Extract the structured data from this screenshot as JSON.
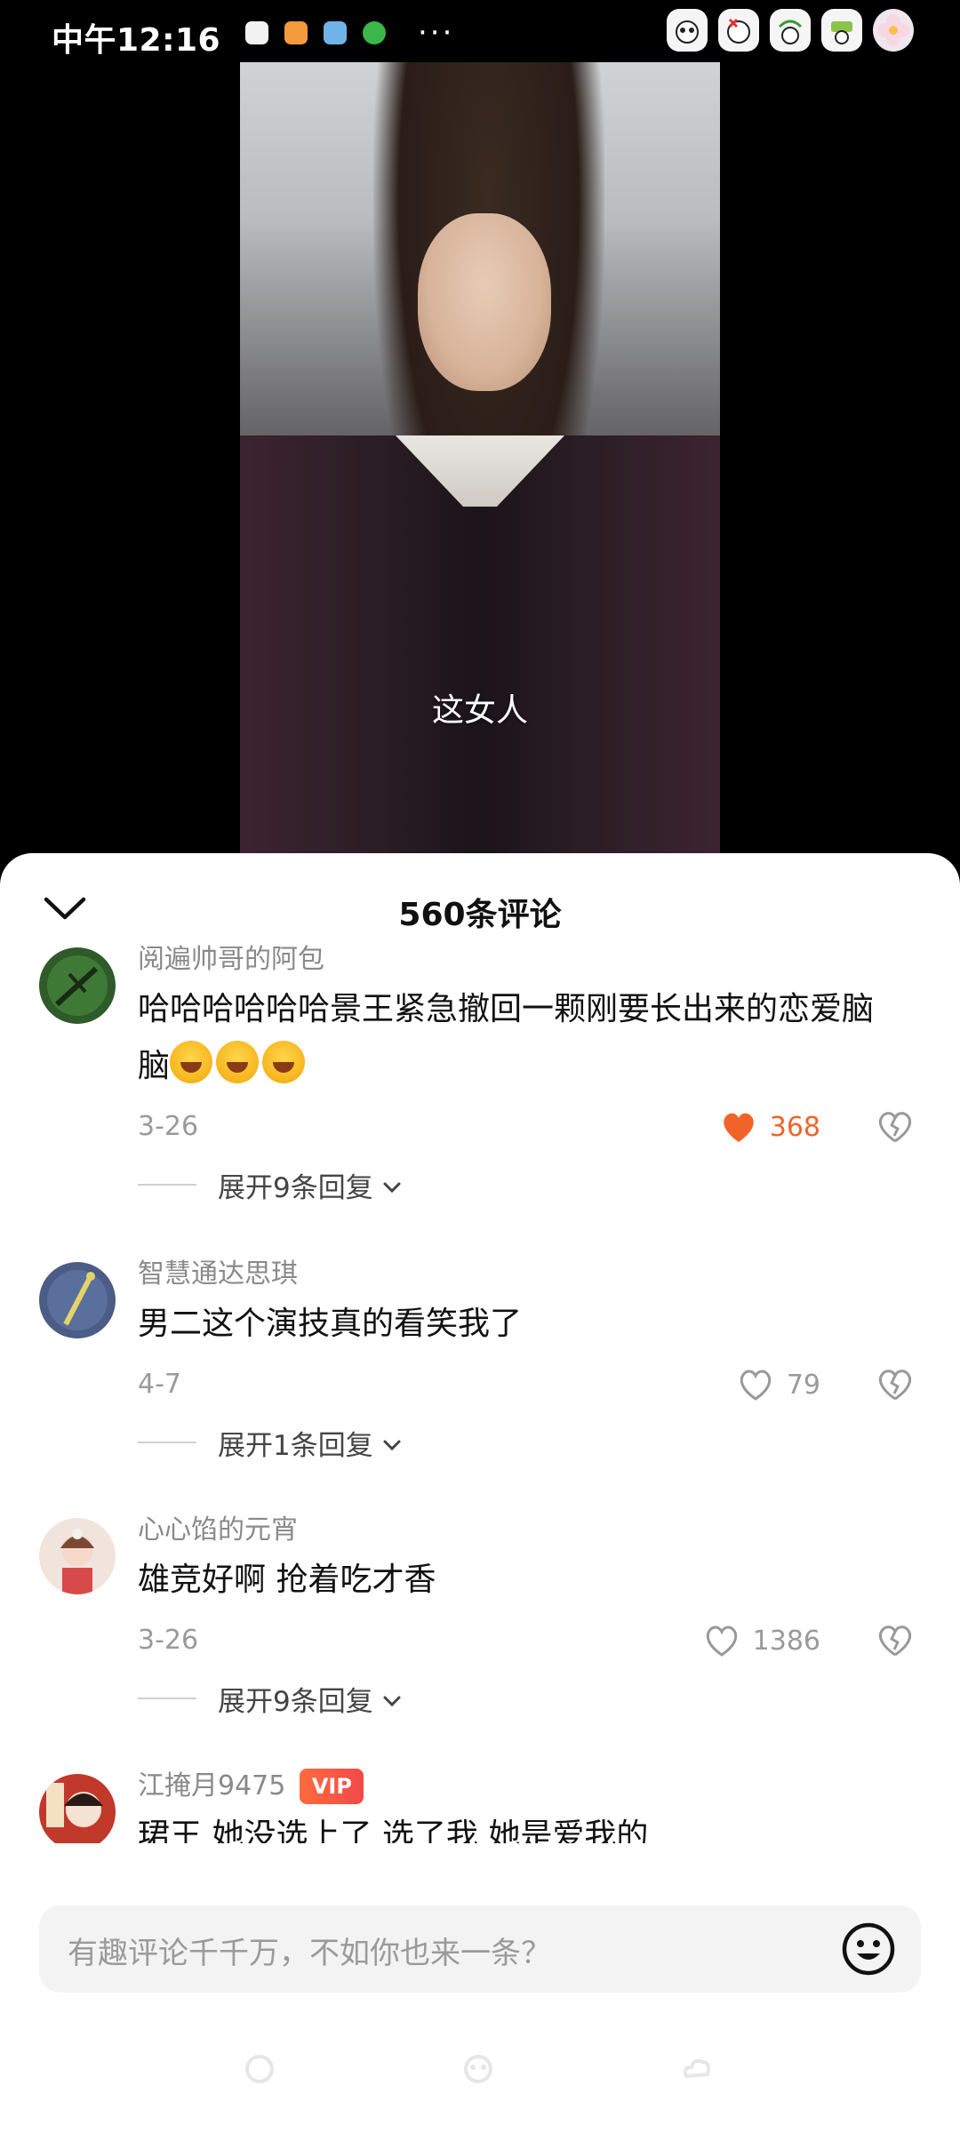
{
  "status_bar": {
    "time": "中午12:16",
    "more": "···",
    "left_icons": [
      "panda-leaf-icon",
      "app-orange-icon",
      "app-blue-icon",
      "wechat-icon"
    ],
    "right_icons": [
      "hd-panda-icon",
      "no-signal-panda-icon",
      "wifi-panda-icon",
      "battery-panda-icon",
      "flower-icon"
    ]
  },
  "video": {
    "subtitle": "这女人"
  },
  "comments_sheet": {
    "title": "560条评论",
    "comments": [
      {
        "username": "阅遍帅哥的阿包",
        "text": "哈哈哈哈哈哈景王紧急撤回一颗刚要长出来的恋爱脑",
        "emojis": [
          "laughing-tears-emoji",
          "laughing-tears-emoji",
          "laughing-tears-emoji"
        ],
        "date": "3-26",
        "likes": "368",
        "liked": true,
        "expand_label": "展开9条回复"
      },
      {
        "username": "智慧通达思琪",
        "text": "男二这个演技真的看笑我了",
        "date": "4-7",
        "likes": "79",
        "liked": false,
        "expand_label": "展开1条回复"
      },
      {
        "username": "心心馅的元宵",
        "text": "雄竞好啊 抢着吃才香",
        "date": "3-26",
        "likes": "1386",
        "liked": false,
        "expand_label": "展开9条回复"
      },
      {
        "username": "江掩月9475",
        "badge": "VIP",
        "text": "珺王 她没选上了 选了我 她是爱我的"
      }
    ]
  },
  "input_bar": {
    "placeholder": "有趣评论千千万，不如你也来一条？"
  },
  "colors": {
    "accent_like": "#f0642a",
    "sheet_bg": "#ffffff",
    "page_bg": "#000000"
  }
}
